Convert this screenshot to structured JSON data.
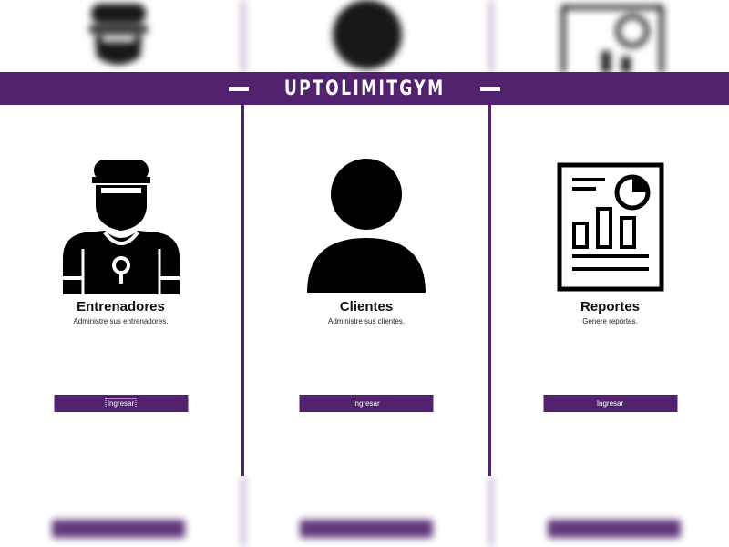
{
  "brand": {
    "name": "UPTOLIMITGYM"
  },
  "colors": {
    "accent": "#52226f",
    "background": "#ffffff",
    "text": "#111111"
  },
  "panels": [
    {
      "icon": "trainer-icon",
      "title": "Entrenadores",
      "description": "Administre sus entrenadores.",
      "button_label": "Ingresar",
      "focused": true
    },
    {
      "icon": "user-icon",
      "title": "Clientes",
      "description": "Administre sus clientes.",
      "button_label": "Ingresar",
      "focused": false
    },
    {
      "icon": "report-icon",
      "title": "Reportes",
      "description": "Genere reportes.",
      "button_label": "Ingresar",
      "focused": false
    }
  ]
}
